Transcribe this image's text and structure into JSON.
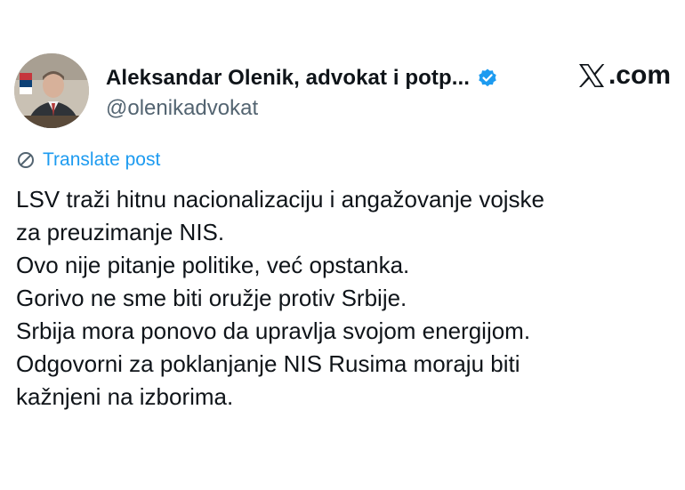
{
  "author": {
    "display_name": "Aleksandar Olenik, advokat i potp...",
    "handle": "@olenikadvokat",
    "verified_icon": "verified-badge-icon",
    "avatar_icon": "profile-photo"
  },
  "brand": {
    "label": ".com",
    "icon": "x-logo-icon"
  },
  "translate": {
    "label": "Translate post",
    "icon": "translate-globe-icon",
    "color": "#1d9bf0"
  },
  "post": {
    "lines": [
      "LSV traži hitnu nacionalizaciju i angažovanje vojske",
      "za preuzimanje NIS.",
      "Ovo nije pitanje politike, već opstanka.",
      "Gorivo ne sme biti oružje protiv Srbije.",
      "Srbija mora ponovo da upravlja svojom energijom.",
      "Odgovorni za poklanjanje NIS Rusima moraju biti",
      "kažnjeni na izborima."
    ]
  },
  "colors": {
    "text": "#0f1419",
    "secondary": "#536471",
    "accent": "#1d9bf0"
  }
}
